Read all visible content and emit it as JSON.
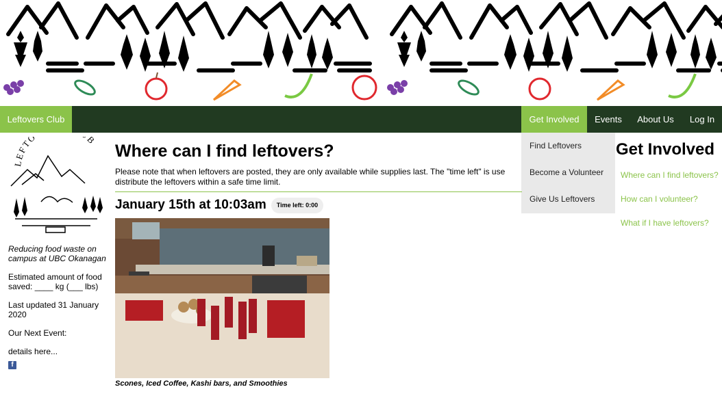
{
  "navbar": {
    "brand": "Leftovers Club",
    "items": [
      {
        "label": "Get Involved"
      },
      {
        "label": "Events"
      },
      {
        "label": "About Us"
      },
      {
        "label": "Log In"
      }
    ],
    "dropdown": [
      {
        "label": "Find Leftovers"
      },
      {
        "label": "Become a Volunteer"
      },
      {
        "label": "Give Us Leftovers"
      }
    ]
  },
  "sidebar": {
    "logo_text": "LEFTOVERS CLUB",
    "tagline": "Reducing food waste on campus at UBC Okanagan",
    "estimate": "Estimated amount of food saved: ____ kg (___ lbs)",
    "updated": "Last updated 31 January 2020",
    "next_event": "Our Next Event:",
    "details": "details here...",
    "social_icon": "facebook-icon"
  },
  "main": {
    "title": "Where can I find leftovers?",
    "notice_line1": "Please note that when leftovers are posted, they are only available while supplies last. The \"time left\" is use",
    "notice_line2": "distribute the leftovers within a safe time limit.",
    "post": {
      "date": "January 15th at 10:03am",
      "time_left": "Time left: 0:00",
      "caption": "Scones, Iced Coffee, Kashi bars, and Smoothies"
    }
  },
  "right": {
    "title": "Get Involved",
    "links": [
      {
        "label": "Where can I find leftovers?"
      },
      {
        "label": "How can I volunteer?"
      },
      {
        "label": "What if I have leftovers?"
      }
    ]
  },
  "colors": {
    "accent": "#8bc34a",
    "nav_bg": "#213a21"
  }
}
